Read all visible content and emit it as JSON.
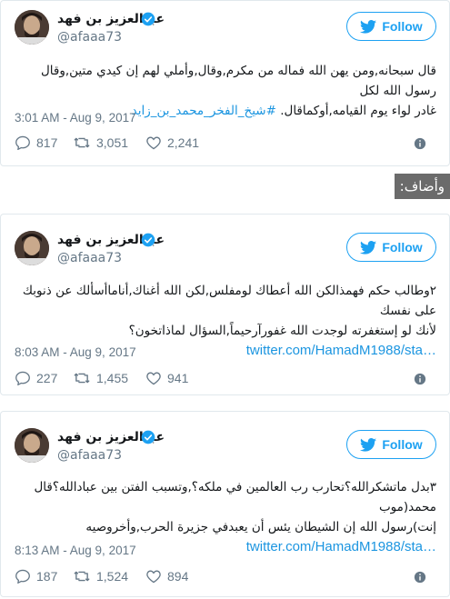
{
  "colors": {
    "accent": "#1da1f2",
    "link": "#1b95e0",
    "muted": "#657786",
    "like_red": "#e0245e"
  },
  "follow_label": "Follow",
  "added_label": "وأضاف:",
  "tweets": [
    {
      "user_name": "عبدالعزيز بن فهد",
      "handle": "@afaaa73",
      "text_line1": "قال سبحانه,ومن يهن الله فماله من مكرم,وقال,وأملي لهم إن كيدي متين,وقال رسول الله لكل",
      "text_line2_plain": "غادر لواء يوم القيامه,أوكماقال. ",
      "hashtag": "#شيخ_الفخر_محمد_بن_زايد",
      "url": "",
      "timestamp": "3:01 AM - Aug 9, 2017",
      "replies": "817",
      "retweets": "3,051",
      "likes": "2,241"
    },
    {
      "user_name": "عبدالعزيز بن فهد",
      "handle": "@afaaa73",
      "text_line1": "٢وطالب حكم فهمذالكن الله أعطاك لومفلس,لكن الله أغناك,أناماأسألك عن ذنوبك على نفسك",
      "text_line2_plain": "لأنك لو إستغفرته لوجدت الله غفورآرحيماً,السؤال لماذاتخون؟",
      "hashtag": "",
      "url": "twitter.com/HamadM1988/sta…",
      "timestamp": "8:03 AM - Aug 9, 2017",
      "replies": "227",
      "retweets": "1,455",
      "likes": "941"
    },
    {
      "user_name": "عبدالعزيز بن فهد",
      "handle": "@afaaa73",
      "text_line1": "٣بدل ماتشكرالله؟تحارب رب العالمين في ملكه؟,وتسبب الفتن بين عبادالله؟قال محمد(موب",
      "text_line2_plain": "إنت)رسول الله إن الشيطان يئس أن يعبدفي جزيرة الحرب,وأخروصيه",
      "hashtag": "",
      "url": "twitter.com/HamadM1988/sta…",
      "timestamp": "8:13 AM - Aug 9, 2017",
      "replies": "187",
      "retweets": "1,524",
      "likes": "894"
    }
  ]
}
